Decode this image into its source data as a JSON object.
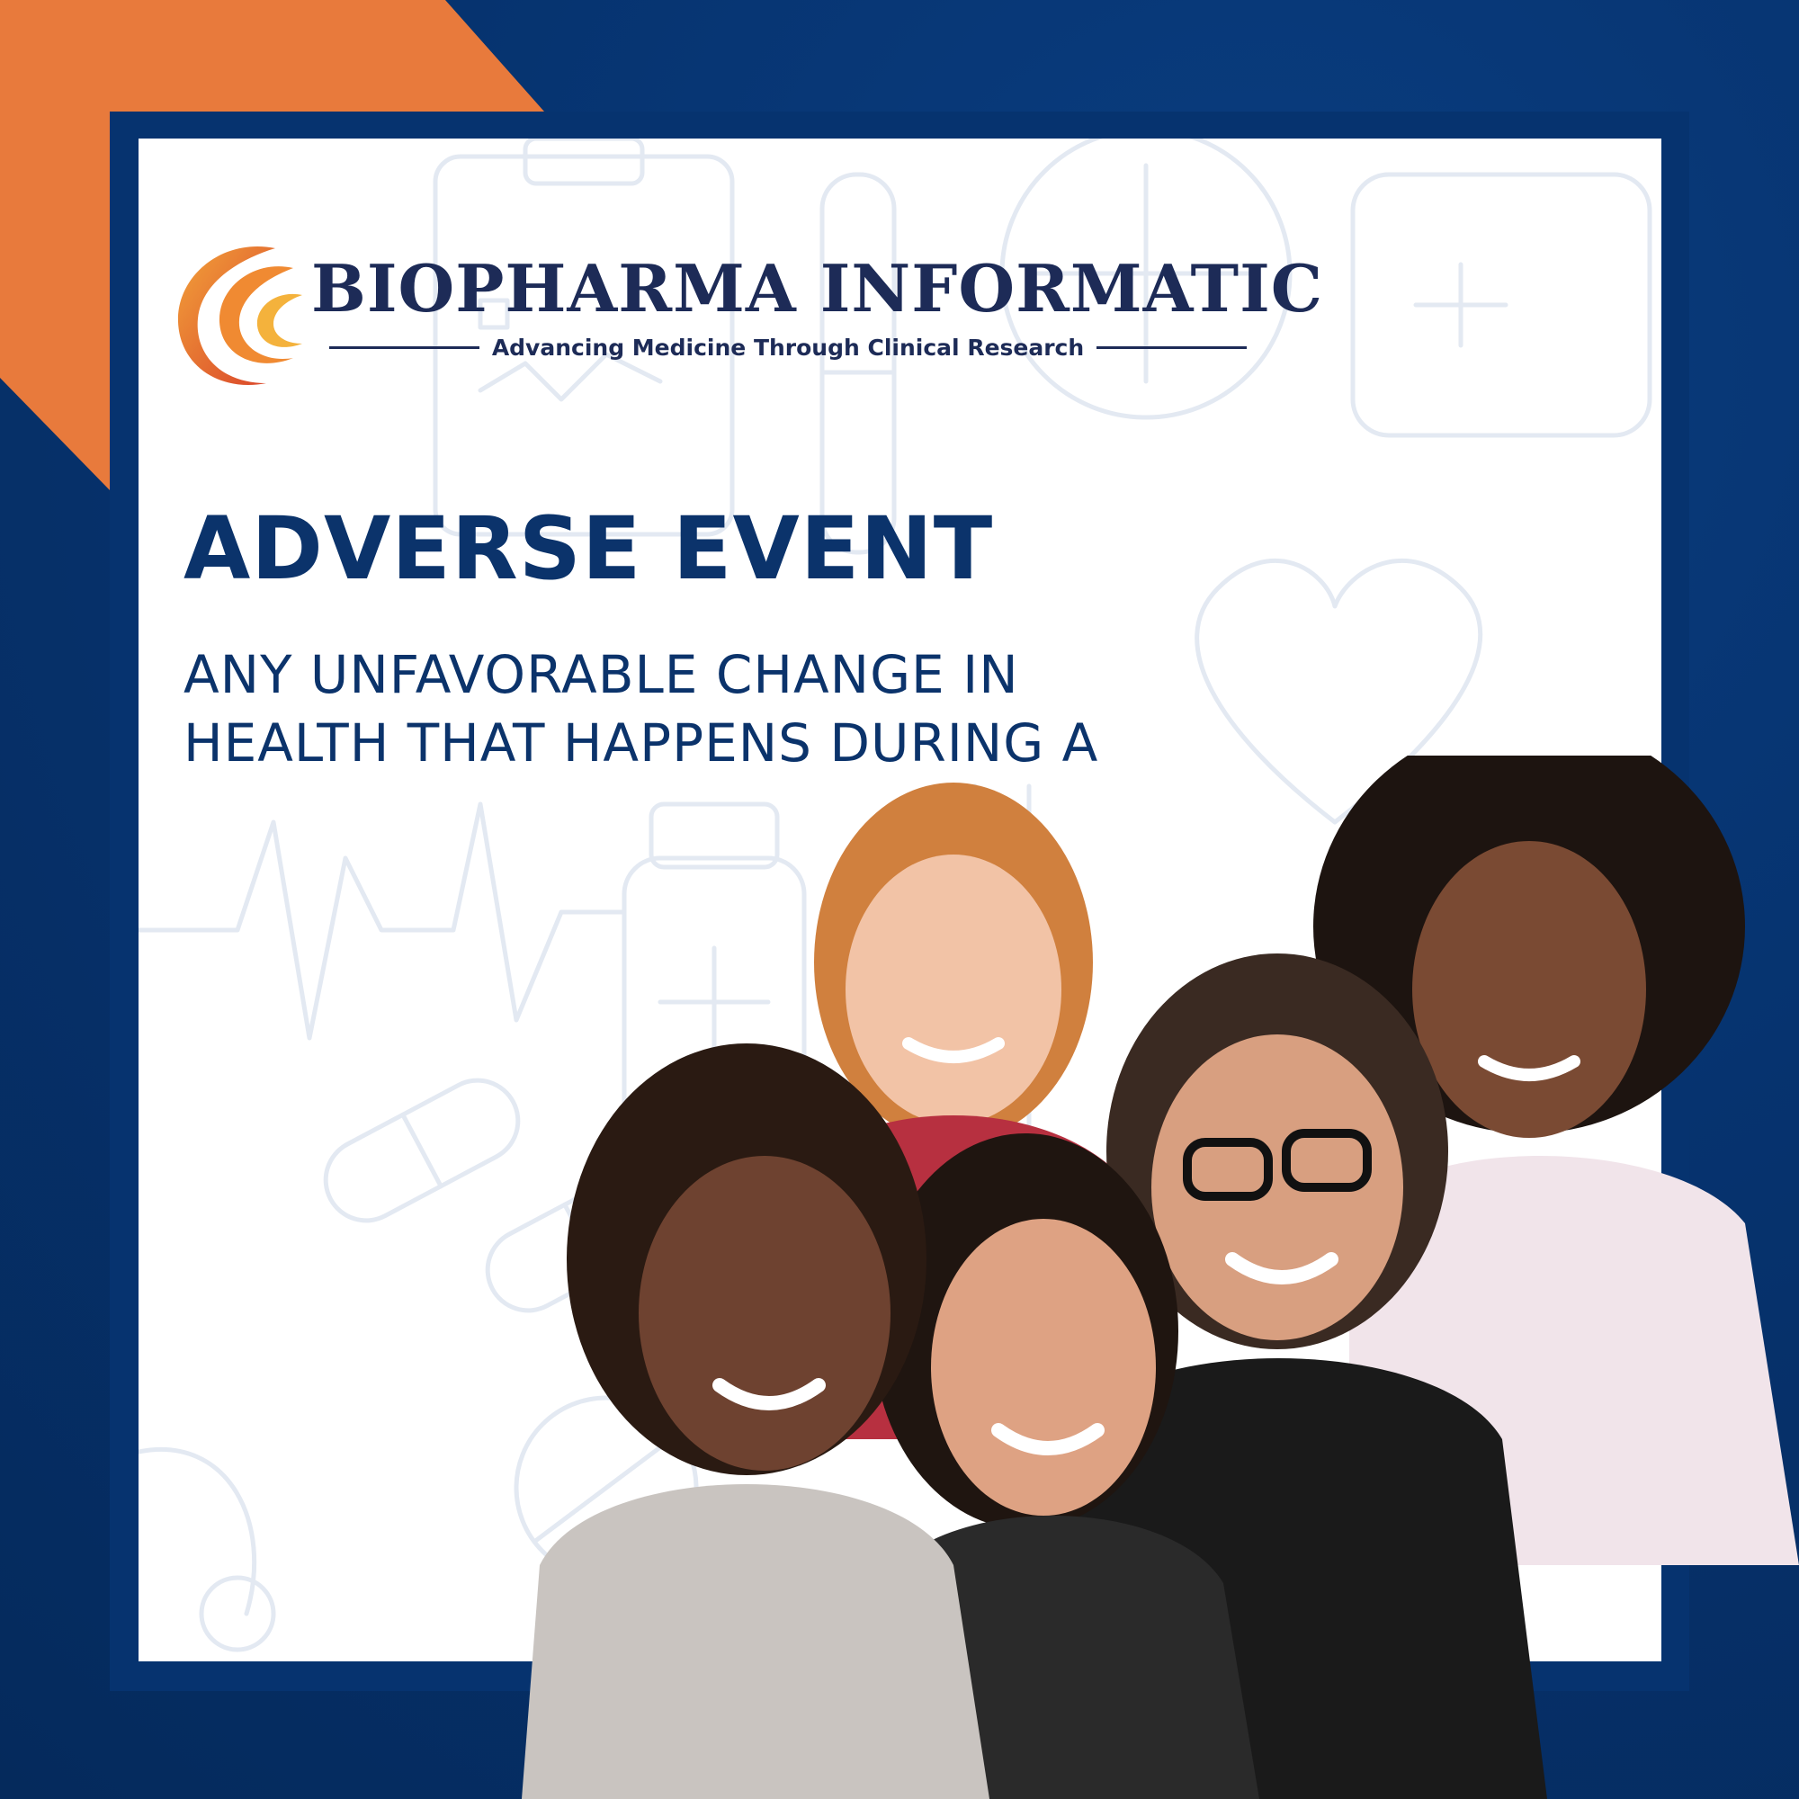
{
  "colors": {
    "navy": "#06336f",
    "orange": "#e87a3c",
    "white": "#ffffff",
    "text": "#0b336b"
  },
  "logo": {
    "name": "BIOPHARMA INFORMATIC",
    "tagline": "Advancing Medicine Through Clinical Research"
  },
  "headline": "ADVERSE EVENT",
  "definition": {
    "line1": "ANY UNFAVORABLE CHANGE IN",
    "line2": "HEALTH THAT HAPPENS DURING A"
  },
  "photo": {
    "subject": "group-of-five-smiling-women"
  }
}
